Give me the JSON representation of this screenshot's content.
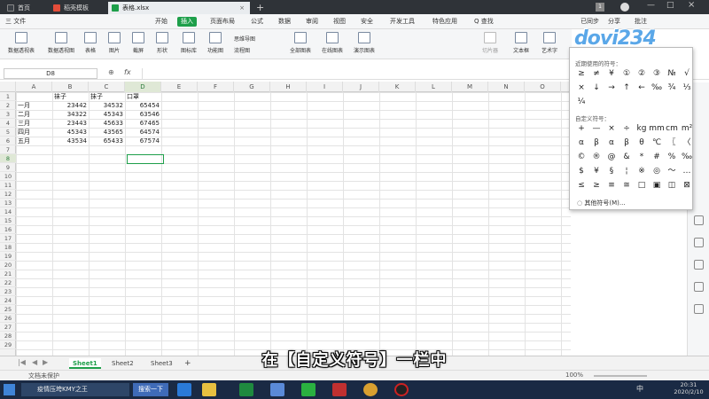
{
  "tabs": [
    {
      "label": "首页",
      "color": "#2f3338",
      "active": false
    },
    {
      "label": "稻壳模板",
      "color": "#e44d3a",
      "active": false
    },
    {
      "label": "表格.xlsx",
      "color": "#1e9f4a",
      "active": true
    },
    {
      "label": "+",
      "active": false
    }
  ],
  "menubar": {
    "file": "三 文件",
    "items": [
      "开始",
      "插入",
      "页面布局",
      "公式",
      "数据",
      "审阅",
      "视图",
      "安全",
      "开发工具",
      "特色应用"
    ],
    "active": "插入",
    "search": "Q 查找",
    "right": [
      "已同步",
      "分享",
      "批注"
    ]
  },
  "ribbon": [
    "数据透视表",
    "数据透视图",
    "表格",
    "图片",
    "截屏",
    "形状",
    "图标库",
    "功能图",
    "思维导图",
    "流程图",
    "全部图表",
    "在线图表",
    "演示图表",
    "切片器",
    "文本框",
    "艺术字"
  ],
  "formula": {
    "namebox": "D8",
    "fx": "fx"
  },
  "columns": [
    "A",
    "B",
    "C",
    "D",
    "E",
    "F",
    "G",
    "H",
    "I",
    "J",
    "K",
    "L",
    "M",
    "N",
    "O"
  ],
  "selected_column": "D",
  "selected_row": "8",
  "rows": [
    "1",
    "2",
    "3",
    "4",
    "5",
    "6",
    "7",
    "8",
    "9",
    "10",
    "11",
    "12",
    "13",
    "14",
    "15",
    "16",
    "17",
    "18",
    "19",
    "20",
    "21",
    "22",
    "23",
    "24",
    "25",
    "26",
    "27",
    "28",
    "29"
  ],
  "table": {
    "headers": [
      "",
      "袜子",
      "抹子",
      "口罩"
    ],
    "data": [
      [
        "一月",
        "23442",
        "34532",
        "65454"
      ],
      [
        "二月",
        "34322",
        "45343",
        "63546"
      ],
      [
        "三月",
        "23443",
        "45633",
        "67465"
      ],
      [
        "四月",
        "45343",
        "43565",
        "64574"
      ],
      [
        "五月",
        "43534",
        "65433",
        "67574"
      ]
    ]
  },
  "sheets": [
    "Sheet1",
    "Sheet2",
    "Sheet3",
    "+"
  ],
  "active_sheet": "Sheet1",
  "status": {
    "left": "文档未保护",
    "zoom": "100%"
  },
  "taskbar": {
    "app1": "疫情压垮KMY之王",
    "app2": "搜索一下",
    "clock_time": "20:31",
    "clock_date": "2020/2/10",
    "ime": "中"
  },
  "symbol_popup": {
    "recent_label": "近期使用的符号：",
    "recent": [
      "≥",
      "≠",
      "¥",
      "①",
      "②",
      "③",
      "№",
      "√",
      "×",
      "↓",
      "→",
      "↑",
      "←",
      "‰",
      "¾",
      "⅓",
      "¼"
    ],
    "custom_label": "自定义符号：",
    "custom": [
      "+",
      "—",
      "×",
      "÷",
      "kg",
      "mm",
      "cm",
      "m²",
      "α",
      "β",
      "α",
      "β",
      "θ",
      "℃",
      "〖",
      "〈",
      "©",
      "®",
      "@",
      "&",
      "*",
      "#",
      "%",
      "‰",
      "$",
      "¥",
      "§",
      "¦",
      "※",
      "◎",
      "～",
      "…",
      "≤",
      "≥",
      "≡",
      "≅",
      "□",
      "▣",
      "◫",
      "⊠"
    ],
    "more": "其他符号(M)..."
  },
  "subtitle": "在【自定义符号】一栏中",
  "watermark": "dovi234",
  "colors": {
    "accent": "#1e9f4a",
    "tabbar": "#2f3338",
    "taskbar": "#1a2a44"
  }
}
